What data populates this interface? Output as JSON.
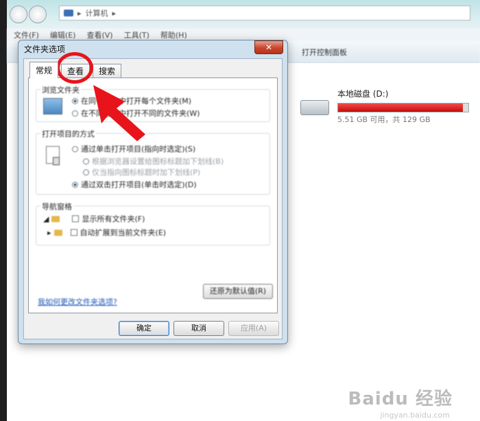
{
  "explorer": {
    "breadcrumb": [
      "计算机"
    ],
    "menu": [
      "文件(F)",
      "编辑(E)",
      "查看(V)",
      "工具(T)",
      "帮助(H)"
    ],
    "toolbar_right": "打开控制面板",
    "drive": {
      "name": "本地磁盘 (D:)",
      "info": "5.51 GB 可用，共 129 GB",
      "used_fraction": 0.957,
      "bar_color": "#d0121a"
    }
  },
  "dialog": {
    "title": "文件夹选项",
    "close_symbol": "✕",
    "tabs": [
      "常规",
      "查看",
      "搜索"
    ],
    "active_tab": "常规",
    "groups": {
      "browse": {
        "title": "浏览文件夹",
        "options": [
          "在同一窗口中打开每个文件夹(M)",
          "在不同窗口中打开不同的文件夹(W)"
        ]
      },
      "click": {
        "title": "打开项目的方式",
        "options": [
          "通过单击打开项目(指向时选定)(S)",
          "根据浏览器设置给图标标题加下划线(B)",
          "仅当指向图标标题时加下划线(P)",
          "通过双击打开项目(单击时选定)(D)"
        ]
      },
      "nav": {
        "title": "导航窗格",
        "options": [
          "显示所有文件夹(F)",
          "自动扩展到当前文件夹(E)"
        ]
      }
    },
    "restore_label": "还原为默认值(R)",
    "help_link": "我如何更改文件夹选项?",
    "buttons": {
      "ok": "确定",
      "cancel": "取消",
      "apply": "应用(A)"
    }
  },
  "watermark": {
    "main": "Baidu 经验",
    "sub": "jingyan.baidu.com"
  },
  "colors": {
    "annotation": "#e8141b",
    "link": "#1c57b7"
  }
}
